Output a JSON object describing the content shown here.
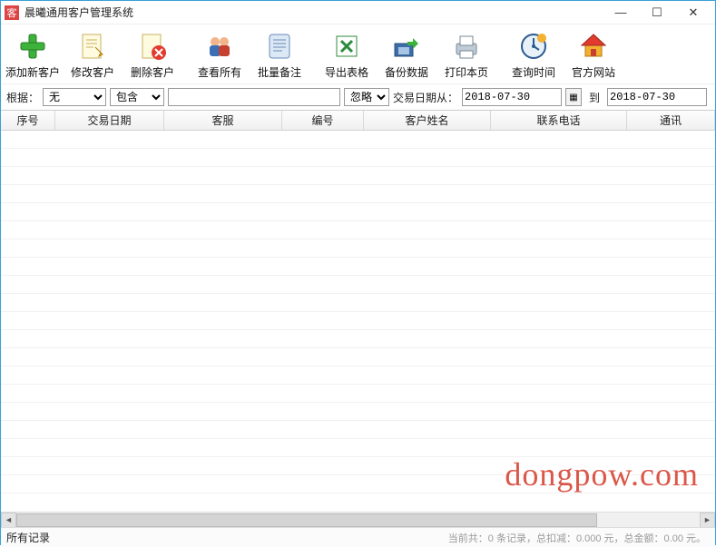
{
  "window": {
    "title": "晨曦通用客户管理系统"
  },
  "toolbar": {
    "add": "添加新客户",
    "edit": "修改客户",
    "delete": "删除客户",
    "viewall": "查看所有",
    "batch": "批量备注",
    "export": "导出表格",
    "backup": "备份数据",
    "print": "打印本页",
    "query": "查询时间",
    "site": "官方网站"
  },
  "filter": {
    "basis_label": "根据：",
    "basis_value": "无",
    "op_value": "包含",
    "search_value": "",
    "ignore_value": "忽略",
    "date_label": "交易日期从：",
    "date_from": "2018-07-30",
    "to_label": "到",
    "date_to": "2018-07-30"
  },
  "columns": {
    "seq": "序号",
    "txdate": "交易日期",
    "agent": "客服",
    "code": "编号",
    "custname": "客户姓名",
    "phone": "联系电话",
    "comm": "通讯"
  },
  "status": {
    "left": "所有记录",
    "right": "当前共：0 条记录，总扣减：0.000 元，总金额：0.00 元。"
  },
  "watermark": "dongpow.com"
}
